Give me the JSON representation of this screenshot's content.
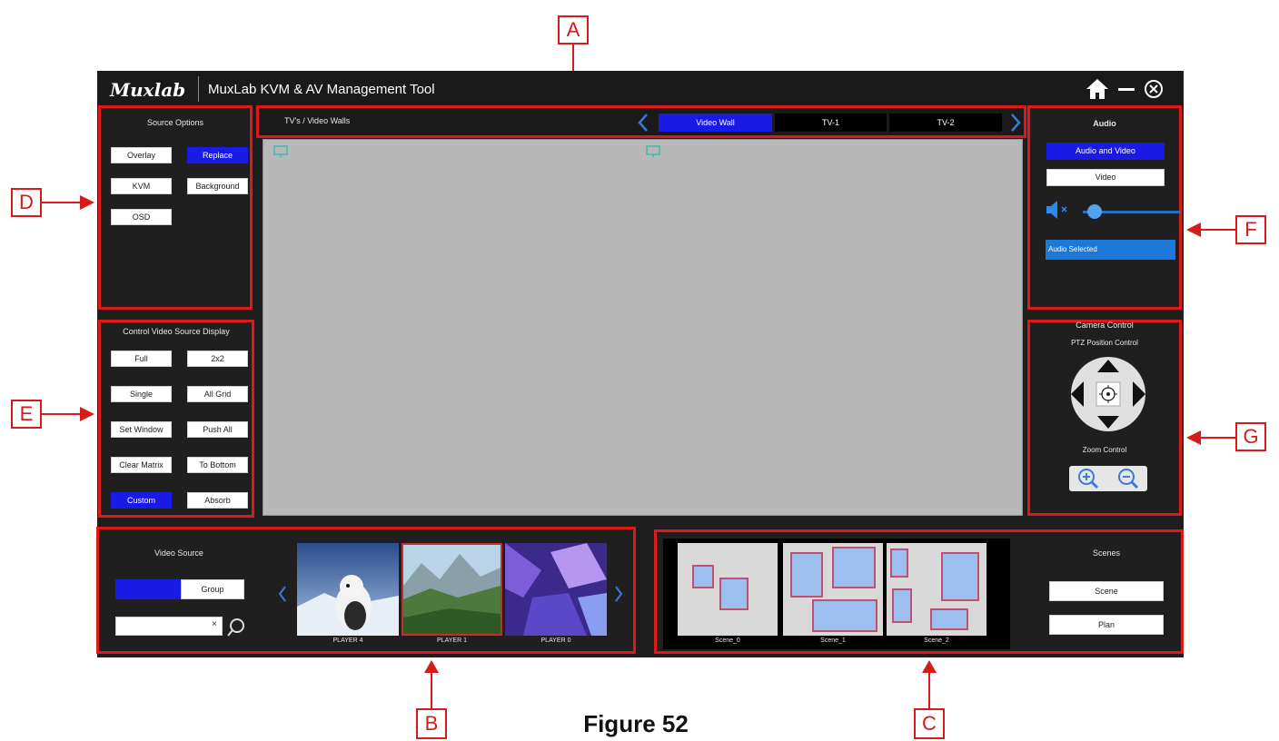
{
  "app": {
    "logo": "Muxlab",
    "title": "MuxLab KVM & AV Management Tool"
  },
  "callouts": {
    "a": "A",
    "b": "B",
    "c": "C",
    "d": "D",
    "e": "E",
    "f": "F",
    "g": "G"
  },
  "figure_caption": "Figure 52",
  "source_options": {
    "title": "Source Options",
    "overlay": "Overlay",
    "replace": "Replace",
    "kvm": "KVM",
    "background": "Background",
    "osd": "OSD"
  },
  "control_display": {
    "title": "Control Video Source Display",
    "buttons": [
      "Full",
      "2x2",
      "Single",
      "All Grid",
      "Set Window",
      "Push All",
      "Clear Matrix",
      "To Bottom",
      "Custom",
      "Absorb"
    ]
  },
  "tv_walls": {
    "title": "TV's / Video Walls",
    "tabs": [
      "Video Wall",
      "TV-1",
      "TV-2"
    ]
  },
  "audio": {
    "title": "Audio",
    "audio_and_video": "Audio and Video",
    "video": "Video",
    "audio_selected": "Audio Selected",
    "volume_level": 0.05
  },
  "camera": {
    "title": "Camera Control",
    "ptz_title": "PTZ Position Control",
    "zoom_title": "Zoom Control"
  },
  "video_source": {
    "title": "Video Source",
    "group": "Group",
    "search_clear": "×",
    "players": [
      "PLAYER 4",
      "PLAYER 1",
      "PLAYER 0"
    ]
  },
  "scenes": {
    "title": "Scenes",
    "scene": "Scene",
    "plan": "Plan",
    "items": [
      "Scene_0",
      "Scene_1",
      "Scene_2"
    ]
  }
}
